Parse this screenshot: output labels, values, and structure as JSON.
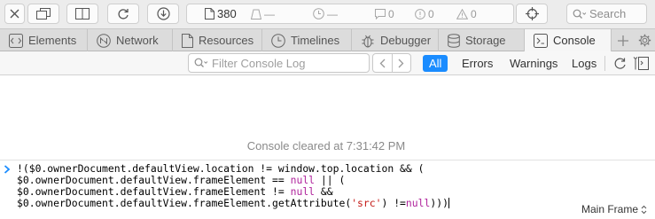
{
  "toolbar": {
    "resource_count": "380",
    "load_time": "—",
    "requests": "—",
    "logs": "0",
    "errors": "0",
    "warnings": "0",
    "search_label": "Search"
  },
  "tabs": [
    {
      "label": "Elements",
      "icon": "elements-icon",
      "active": false
    },
    {
      "label": "Network",
      "icon": "network-icon",
      "active": false
    },
    {
      "label": "Resources",
      "icon": "resources-icon",
      "active": false
    },
    {
      "label": "Timelines",
      "icon": "timelines-icon",
      "active": false
    },
    {
      "label": "Debugger",
      "icon": "debugger-icon",
      "active": false
    },
    {
      "label": "Storage",
      "icon": "storage-icon",
      "active": false
    },
    {
      "label": "Console",
      "icon": "console-icon",
      "active": true
    }
  ],
  "filter": {
    "placeholder": "Filter Console Log",
    "scopes": [
      "All",
      "Errors",
      "Warnings",
      "Logs"
    ],
    "active_scope": "All"
  },
  "console": {
    "cleared_message": "Console cleared at 7:31:42 PM",
    "prompt_lines": [
      "!($0.ownerDocument.defaultView.location != window.top.location && (",
      "$0.ownerDocument.defaultView.frameElement == null || (",
      "$0.ownerDocument.defaultView.frameElement != null &&",
      "$0.ownerDocument.defaultView.frameElement.getAttribute('src') !=null)))"
    ],
    "frame_selector": "Main Frame"
  },
  "colors": {
    "accent": "#1a8cff",
    "toolbar_bg": "#ececec",
    "tabbar_bg": "#dcdcdc"
  }
}
